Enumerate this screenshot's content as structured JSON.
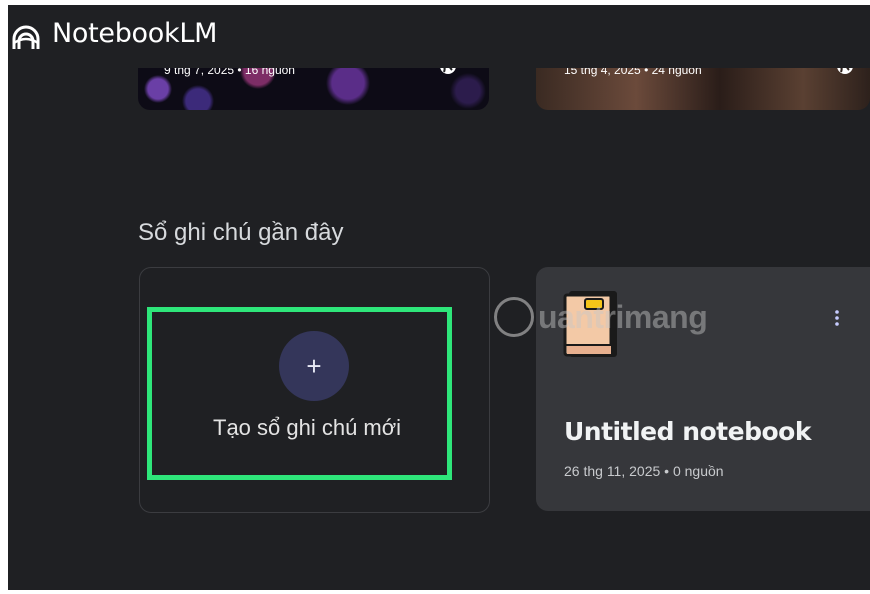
{
  "app": {
    "name": "NotebookLM"
  },
  "featured": [
    {
      "meta": "9 thg 7, 2025 • 16 nguồn"
    },
    {
      "meta": "15 thg 4, 2025 • 24 nguồn"
    }
  ],
  "recent": {
    "section_title": "Sổ ghi chú gần đây",
    "create_label": "Tạo sổ ghi chú mới",
    "create_icon": "+",
    "notebooks": [
      {
        "title": "Untitled notebook",
        "meta": "26 thg 11, 2025 • 0 nguồn",
        "icon": "book-icon"
      }
    ]
  },
  "watermark": {
    "text": "uantrimang"
  },
  "colors": {
    "background": "#1f2023",
    "card": "#36373b",
    "highlight": "#2ee67a",
    "plus_circle": "#34365a"
  }
}
